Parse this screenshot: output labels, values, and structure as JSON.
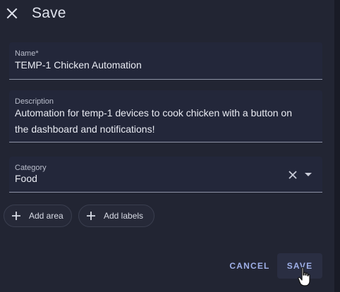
{
  "dialog": {
    "title": "Save"
  },
  "form": {
    "name": {
      "label": "Name*",
      "value": "TEMP-1 Chicken Automation"
    },
    "description": {
      "label": "Description",
      "line1": "Automation for temp-1 devices to cook chicken with a button on",
      "line2": "the dashboard and notifications!"
    },
    "category": {
      "label": "Category",
      "value": "Food"
    }
  },
  "chips": {
    "add_area": "Add area",
    "add_labels": "Add labels"
  },
  "actions": {
    "cancel": "CANCEL",
    "save": "SAVE"
  },
  "colors": {
    "background": "#222533",
    "accent": "#9fb0e8",
    "text": "#e4e6ee"
  },
  "icons": [
    "close-icon",
    "clear-icon",
    "dropdown-arrow-icon",
    "plus-icon",
    "hand-pointer-icon"
  ]
}
